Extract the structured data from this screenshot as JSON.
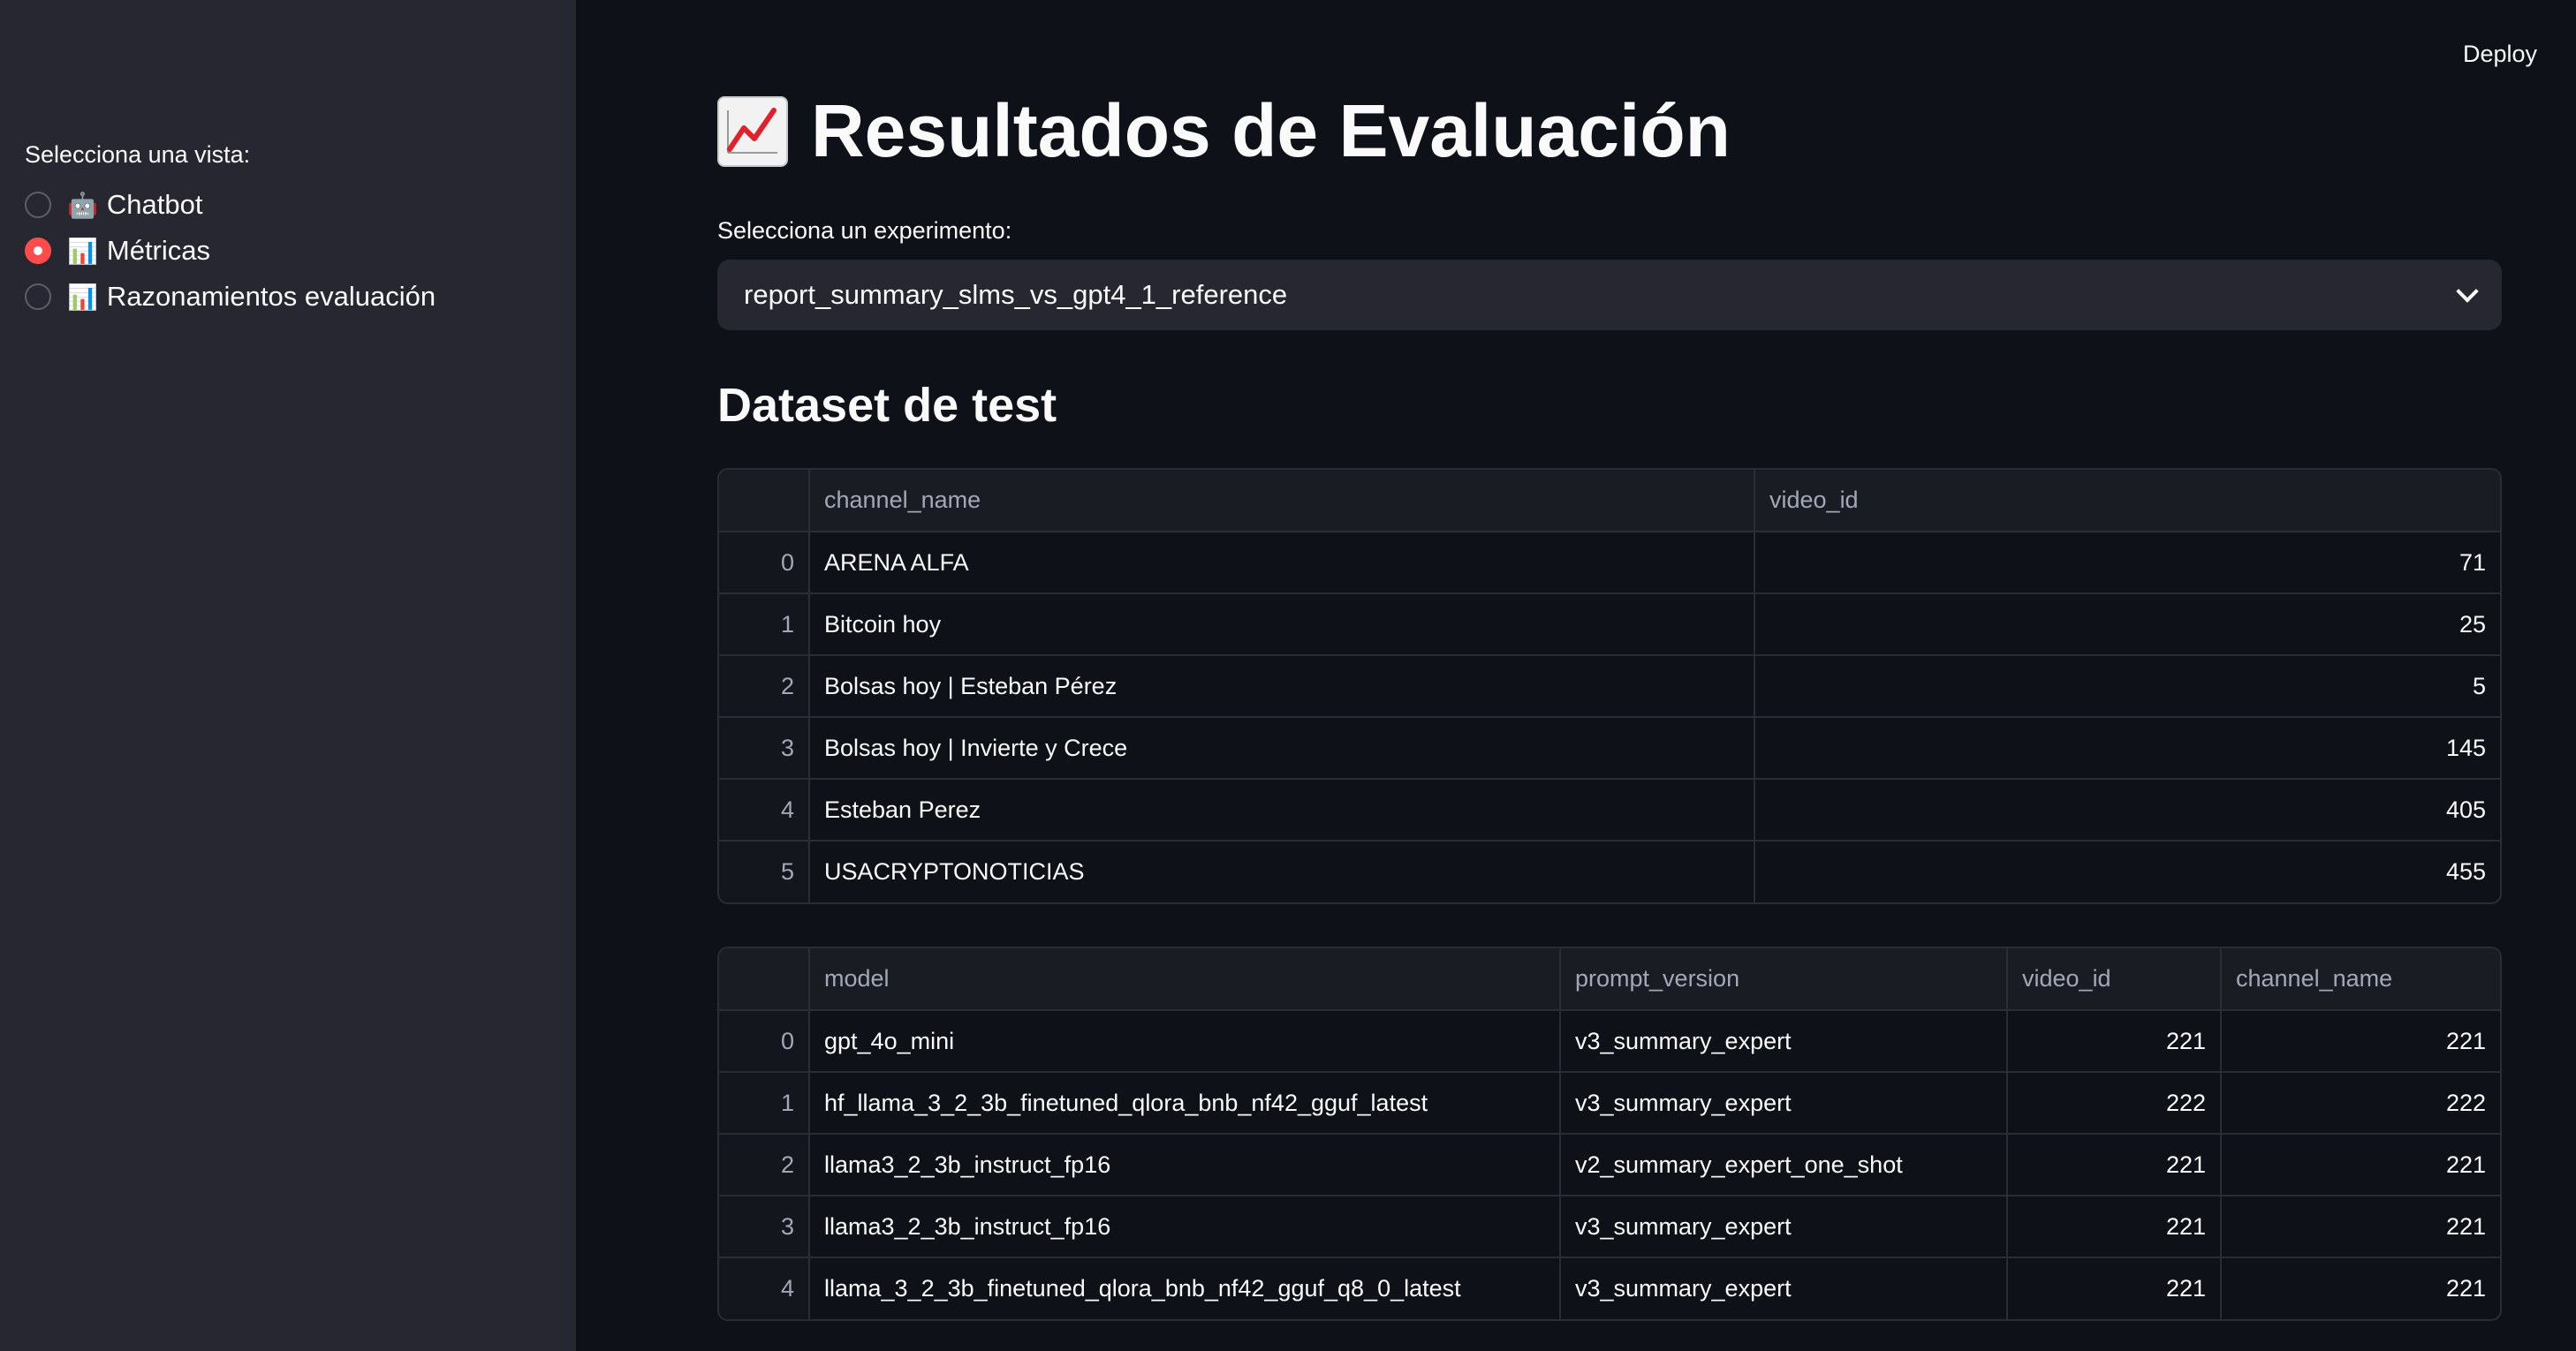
{
  "sidebar": {
    "label": "Selecciona una vista:",
    "options": [
      {
        "icon": "🤖",
        "label": "Chatbot",
        "checked": false
      },
      {
        "icon": "📊",
        "label": "Métricas",
        "checked": true
      },
      {
        "icon": "📊",
        "label": "Razonamientos evaluación",
        "checked": false
      }
    ]
  },
  "header": {
    "deploy_label": "Deploy"
  },
  "main": {
    "title": "Resultados de Evaluación",
    "title_icon": "chart-increasing-icon",
    "select_label": "Selecciona un experimento:",
    "select_value": "report_summary_slms_vs_gpt4_1_reference",
    "section_title": "Dataset de test"
  },
  "table1": {
    "columns": [
      "channel_name",
      "video_id"
    ],
    "rows": [
      {
        "index": "0",
        "channel_name": "ARENA ALFA",
        "video_id": "71"
      },
      {
        "index": "1",
        "channel_name": "Bitcoin hoy",
        "video_id": "25"
      },
      {
        "index": "2",
        "channel_name": "Bolsas hoy | Esteban Pérez",
        "video_id": "5"
      },
      {
        "index": "3",
        "channel_name": "Bolsas hoy | Invierte y Crece",
        "video_id": "145"
      },
      {
        "index": "4",
        "channel_name": "Esteban Perez",
        "video_id": "405"
      },
      {
        "index": "5",
        "channel_name": "USACRYPTONOTICIAS",
        "video_id": "455"
      }
    ]
  },
  "table2": {
    "columns": [
      "model",
      "prompt_version",
      "video_id",
      "channel_name"
    ],
    "rows": [
      {
        "index": "0",
        "model": "gpt_4o_mini",
        "prompt_version": "v3_summary_expert",
        "video_id": "221",
        "channel_name": "221"
      },
      {
        "index": "1",
        "model": "hf_llama_3_2_3b_finetuned_qlora_bnb_nf42_gguf_latest",
        "prompt_version": "v3_summary_expert",
        "video_id": "222",
        "channel_name": "222"
      },
      {
        "index": "2",
        "model": "llama3_2_3b_instruct_fp16",
        "prompt_version": "v2_summary_expert_one_shot",
        "video_id": "221",
        "channel_name": "221"
      },
      {
        "index": "3",
        "model": "llama3_2_3b_instruct_fp16",
        "prompt_version": "v3_summary_expert",
        "video_id": "221",
        "channel_name": "221"
      },
      {
        "index": "4",
        "model": "llama_3_2_3b_finetuned_qlora_bnb_nf42_gguf_q8_0_latest",
        "prompt_version": "v3_summary_expert",
        "video_id": "221",
        "channel_name": "221"
      }
    ]
  },
  "colors": {
    "sidebar_bg": "#262730",
    "main_bg": "#0e1117",
    "accent": "#ff4b4b"
  }
}
